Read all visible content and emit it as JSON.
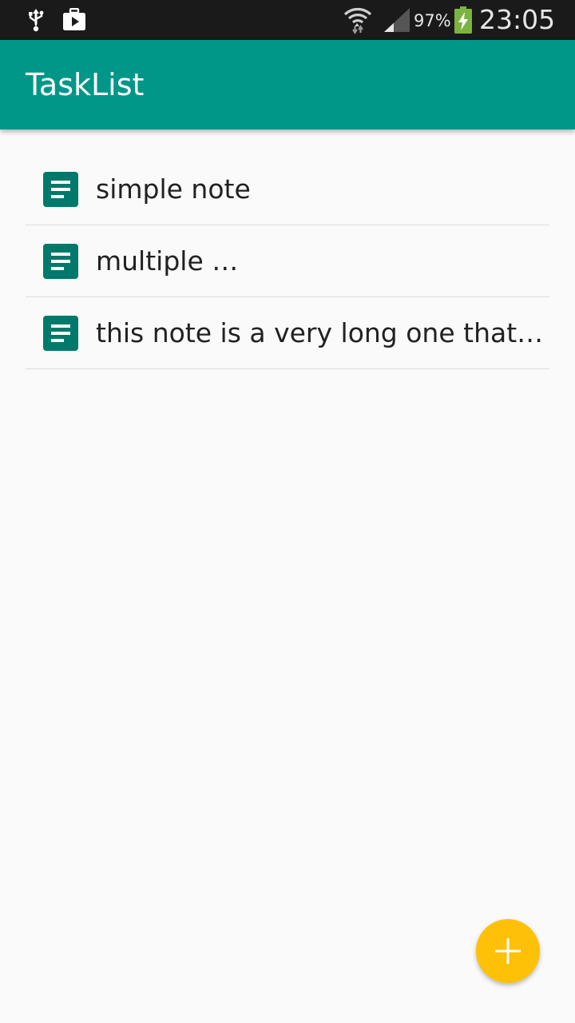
{
  "status_bar": {
    "battery_percent": "97%",
    "time": "23:05",
    "icons": [
      "usb-icon",
      "media-icon",
      "wifi-icon",
      "signal-icon",
      "battery-charging-icon"
    ]
  },
  "app_bar": {
    "title": "TaskList",
    "color": "#009688"
  },
  "notes": [
    {
      "text": "simple note",
      "icon": "note-icon"
    },
    {
      "text": "multiple …",
      "icon": "note-icon"
    },
    {
      "text": "this note is a very long one that…",
      "icon": "note-icon"
    }
  ],
  "fab": {
    "icon": "plus-icon",
    "color": "#ffc107"
  },
  "colors": {
    "primary": "#009688",
    "primary_dark": "#00796b",
    "accent": "#ffc107",
    "background": "#fafafa"
  }
}
